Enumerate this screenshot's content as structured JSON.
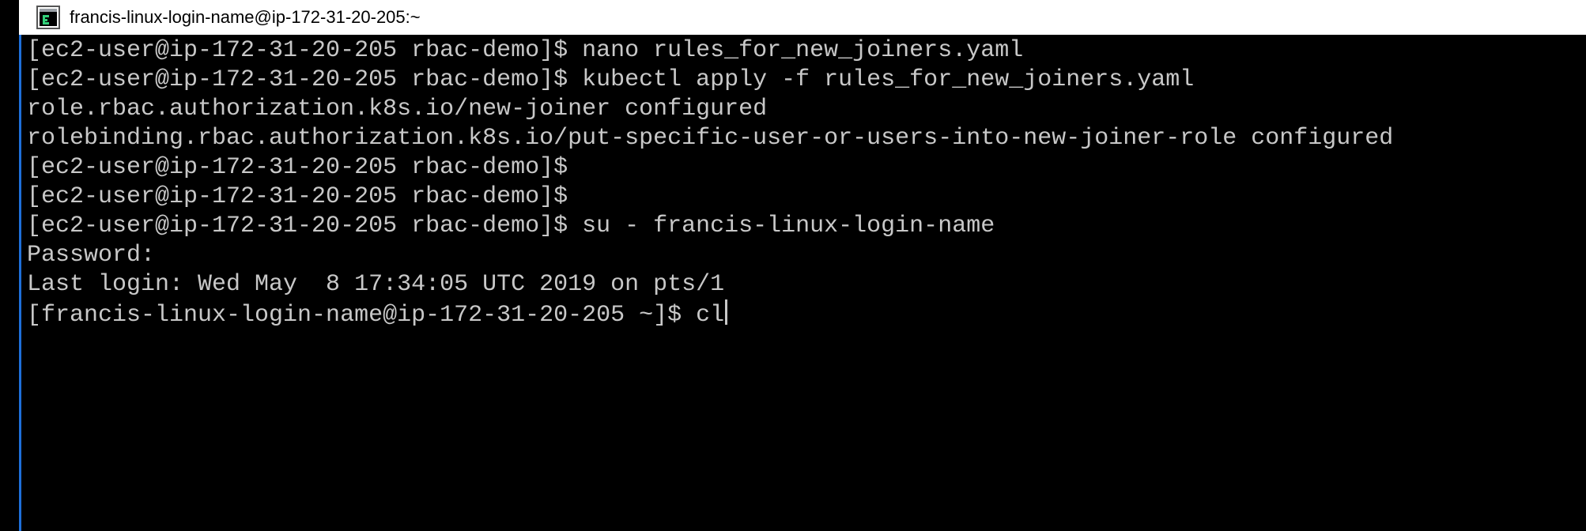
{
  "window": {
    "title": "francis-linux-login-name@ip-172-31-20-205:~",
    "icon": "terminal-icon"
  },
  "terminal": {
    "lines": [
      "[ec2-user@ip-172-31-20-205 rbac-demo]$ nano rules_for_new_joiners.yaml",
      "[ec2-user@ip-172-31-20-205 rbac-demo]$ kubectl apply -f rules_for_new_joiners.yaml",
      "role.rbac.authorization.k8s.io/new-joiner configured",
      "rolebinding.rbac.authorization.k8s.io/put-specific-user-or-users-into-new-joiner-role configured",
      "[ec2-user@ip-172-31-20-205 rbac-demo]$",
      "[ec2-user@ip-172-31-20-205 rbac-demo]$",
      "[ec2-user@ip-172-31-20-205 rbac-demo]$ su - francis-linux-login-name",
      "Password:",
      "Last login: Wed May  8 17:34:05 UTC 2019 on pts/1",
      "[francis-linux-login-name@ip-172-31-20-205 ~]$ cl"
    ]
  },
  "colors": {
    "terminal_bg": "#000000",
    "terminal_fg": "#c8c8c8",
    "accent": "#1e6fd9"
  }
}
